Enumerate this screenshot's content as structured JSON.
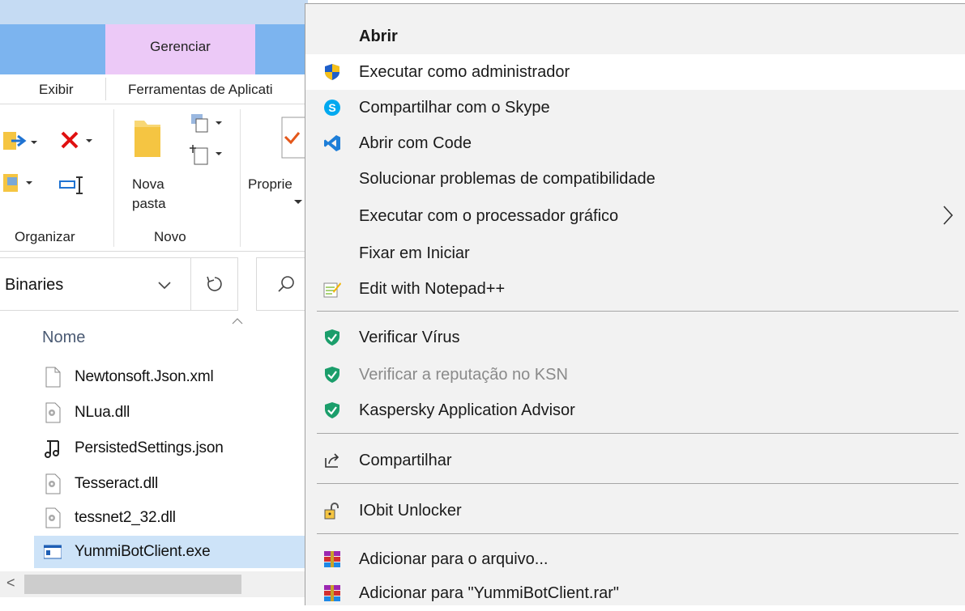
{
  "explorer": {
    "ribbon_context_tab": "Gerenciar",
    "ribbon_tabs": [
      "Exibir",
      "Ferramentas de Aplicati"
    ],
    "ribbon": {
      "nova_pasta_label_1": "Nova",
      "nova_pasta_label_2": "pasta",
      "propriedades_label": "Proprie",
      "group_organizar": "Organizar",
      "group_novo": "Novo"
    },
    "address_path": "Binaries",
    "column_header": "Nome",
    "files": [
      {
        "name": "Newtonsoft.Json.xml",
        "icon": "document-icon"
      },
      {
        "name": "NLua.dll",
        "icon": "dll-gear-icon"
      },
      {
        "name": "PersistedSettings.json",
        "icon": "music-note-icon"
      },
      {
        "name": "Tesseract.dll",
        "icon": "dll-gear-icon"
      },
      {
        "name": "tessnet2_32.dll",
        "icon": "dll-gear-icon"
      },
      {
        "name": "YummiBotClient.exe",
        "icon": "exe-window-icon",
        "selected": true
      }
    ]
  },
  "context_menu": {
    "items": [
      {
        "label": "Abrir",
        "bold": true
      },
      {
        "label": "Executar como administrador",
        "icon": "uac-shield-icon",
        "highlighted": true
      },
      {
        "label": "Compartilhar com o Skype",
        "icon": "skype-icon"
      },
      {
        "label": "Abrir com Code",
        "icon": "vscode-icon"
      },
      {
        "label": "Solucionar problemas de compatibilidade"
      },
      {
        "label": "Executar com o processador gráfico",
        "submenu": true
      },
      {
        "label": "Fixar em Iniciar"
      },
      {
        "label": "Edit with Notepad++",
        "icon": "notepadpp-icon"
      },
      {
        "label": "Verificar Vírus",
        "icon": "kaspersky-shield-icon"
      },
      {
        "label": "Verificar a reputação no KSN",
        "icon": "kaspersky-shield-icon",
        "disabled": true
      },
      {
        "label": "Kaspersky Application Advisor",
        "icon": "kaspersky-shield-icon"
      },
      {
        "label": "Compartilhar",
        "icon": "share-icon"
      },
      {
        "label": "IObit Unlocker",
        "icon": "unlock-icon"
      },
      {
        "label": "Adicionar para o arquivo...",
        "icon": "winrar-icon"
      },
      {
        "label": "Adicionar para \"YummiBotClient.rar\"",
        "icon": "winrar-icon"
      }
    ]
  },
  "colors": {
    "menu_bg": "#f2f2f2",
    "selection": "#cde3f8",
    "ribbon_manage_tab": "#ecc9f7",
    "kaspersky_green": "#1b9e6b"
  }
}
